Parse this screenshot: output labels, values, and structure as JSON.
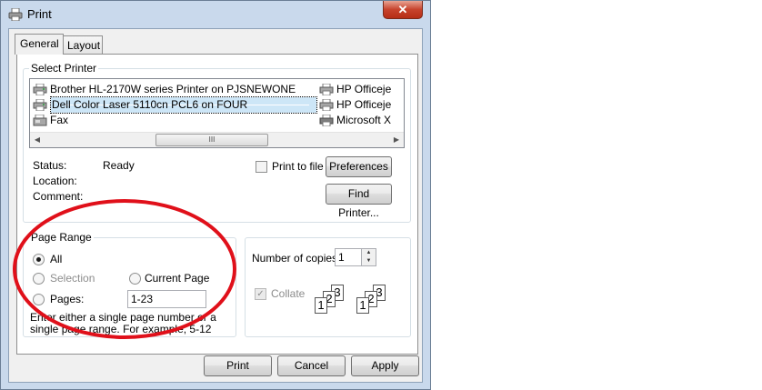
{
  "window": {
    "title": "Print",
    "close_label": "✕"
  },
  "tabs": [
    {
      "label": "General"
    },
    {
      "label": "Layout"
    }
  ],
  "select_printer": {
    "group_label": "Select Printer",
    "printers": [
      {
        "name": "Brother HL-2170W series Printer on PJSNEWONE",
        "selected": false
      },
      {
        "name": "Dell Color Laser 5110cn PCL6 on FOUR",
        "selected": true
      },
      {
        "name": "Fax",
        "selected": false
      },
      {
        "name": "HP Officeje",
        "selected": false
      },
      {
        "name": "HP Officeje",
        "selected": false
      },
      {
        "name": "Microsoft X",
        "selected": false
      }
    ],
    "scroll_left": "◀",
    "scroll_right": "▶",
    "scroll_grip": "III",
    "status_label": "Status:",
    "status_value": "Ready",
    "location_label": "Location:",
    "location_value": "",
    "comment_label": "Comment:",
    "comment_value": "",
    "print_to_file_label": "Print to file",
    "preferences_label": "Preferences",
    "find_printer_label": "Find Printer..."
  },
  "page_range": {
    "group_label": "Page Range",
    "all_label": "All",
    "selection_label": "Selection",
    "current_page_label": "Current Page",
    "pages_label": "Pages:",
    "pages_value": "1-23",
    "hint": "Enter either a single page number or a single page range.  For example, 5-12",
    "selected": "All"
  },
  "copies": {
    "number_label": "Number of copies:",
    "number_value": "1",
    "collate_label": "Collate",
    "collate_checked": true,
    "collate_enabled": false,
    "collate_pages": [
      "1",
      "2",
      "3"
    ]
  },
  "footer": {
    "print_label": "Print",
    "cancel_label": "Cancel",
    "apply_label": "Apply"
  },
  "colors": {
    "annotation": "#e0101a",
    "selection": "#cde6f7",
    "title_bar": "#c9d9ec"
  }
}
